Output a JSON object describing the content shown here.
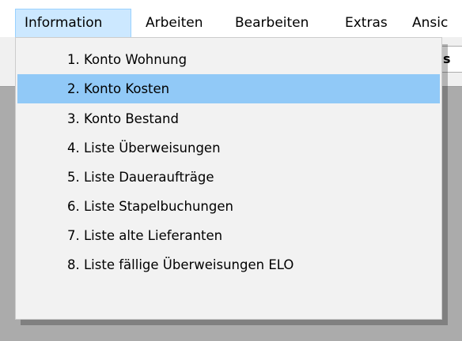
{
  "menubar": {
    "items": [
      {
        "label": "Information",
        "open": true
      },
      {
        "label": "Arbeiten"
      },
      {
        "label": "Bearbeiten"
      },
      {
        "label": "Extras"
      },
      {
        "label": "Ansic"
      }
    ]
  },
  "toolbar": {
    "edge_label": "s"
  },
  "dropdown": {
    "selected_index": 1,
    "items": [
      {
        "label": "1. Konto Wohnung"
      },
      {
        "label": "2. Konto Kosten"
      },
      {
        "label": "3. Konto Bestand"
      },
      {
        "label": "4. Liste Überweisungen"
      },
      {
        "label": "5. Liste Daueraufträge"
      },
      {
        "label": "6. Liste Stapelbuchungen"
      },
      {
        "label": "7. Liste alte Lieferanten"
      },
      {
        "label": "8. Liste fällige Überweisungen ELO"
      }
    ]
  },
  "colors": {
    "background": "#ababab",
    "menu_open_bg": "#cce8ff",
    "menu_open_border": "#99d1ff",
    "dropdown_bg": "#f2f2f2",
    "selected_bg": "#91c9f7"
  }
}
